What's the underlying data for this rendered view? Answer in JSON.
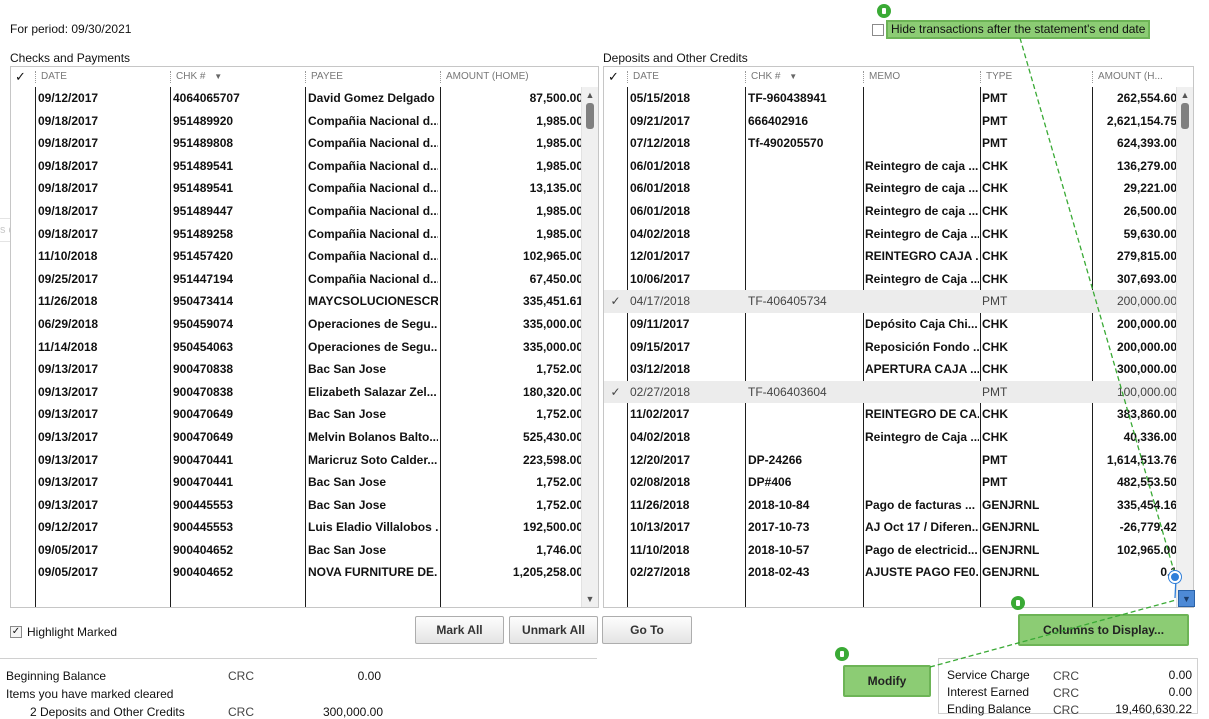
{
  "period_label": "For period: 09/30/2021",
  "hide_transactions_label": "Hide transactions after the statement's end date",
  "ghost_text": "s doin",
  "checks": {
    "title": "Checks and Payments",
    "columns": [
      "✓",
      "DATE",
      "CHK #",
      "PAYEE",
      "AMOUNT (HOME)"
    ],
    "sort_arrow": "▼",
    "rows": [
      {
        "date": "09/12/2017",
        "chk": "4064065707",
        "payee": "David Gomez Delgado",
        "amount": "87,500.00",
        "marked": false
      },
      {
        "date": "09/18/2017",
        "chk": "951489920",
        "payee": "Compañia Nacional d...",
        "amount": "1,985.00",
        "marked": false
      },
      {
        "date": "09/18/2017",
        "chk": "951489808",
        "payee": "Compañia Nacional d...",
        "amount": "1,985.00",
        "marked": false
      },
      {
        "date": "09/18/2017",
        "chk": "951489541",
        "payee": "Compañia Nacional d...",
        "amount": "1,985.00",
        "marked": false
      },
      {
        "date": "09/18/2017",
        "chk": "951489541",
        "payee": "Compañia Nacional d...",
        "amount": "13,135.00",
        "marked": false
      },
      {
        "date": "09/18/2017",
        "chk": "951489447",
        "payee": "Compañia Nacional d...",
        "amount": "1,985.00",
        "marked": false
      },
      {
        "date": "09/18/2017",
        "chk": "951489258",
        "payee": "Compañia Nacional d...",
        "amount": "1,985.00",
        "marked": false
      },
      {
        "date": "11/10/2018",
        "chk": "951457420",
        "payee": "Compañia Nacional d...",
        "amount": "102,965.00",
        "marked": false
      },
      {
        "date": "09/25/2017",
        "chk": "951447194",
        "payee": "Compañia Nacional d...",
        "amount": "67,450.00",
        "marked": false
      },
      {
        "date": "11/26/2018",
        "chk": "950473414",
        "payee": "MAYCSOLUCIONESCR...",
        "amount": "335,451.61",
        "marked": false
      },
      {
        "date": "06/29/2018",
        "chk": "950459074",
        "payee": "Operaciones de Segu...",
        "amount": "335,000.00",
        "marked": false
      },
      {
        "date": "11/14/2018",
        "chk": "950454063",
        "payee": "Operaciones de Segu...",
        "amount": "335,000.00",
        "marked": false
      },
      {
        "date": "09/13/2017",
        "chk": "900470838",
        "payee": "Bac San Jose",
        "amount": "1,752.00",
        "marked": false
      },
      {
        "date": "09/13/2017",
        "chk": "900470838",
        "payee": "Elizabeth Salazar Zel...",
        "amount": "180,320.00",
        "marked": false
      },
      {
        "date": "09/13/2017",
        "chk": "900470649",
        "payee": "Bac San Jose",
        "amount": "1,752.00",
        "marked": false
      },
      {
        "date": "09/13/2017",
        "chk": "900470649",
        "payee": "Melvin Bolanos Balto...",
        "amount": "525,430.00",
        "marked": false
      },
      {
        "date": "09/13/2017",
        "chk": "900470441",
        "payee": "Maricruz Soto Calder...",
        "amount": "223,598.00",
        "marked": false
      },
      {
        "date": "09/13/2017",
        "chk": "900470441",
        "payee": "Bac San Jose",
        "amount": "1,752.00",
        "marked": false
      },
      {
        "date": "09/13/2017",
        "chk": "900445553",
        "payee": "Bac San Jose",
        "amount": "1,752.00",
        "marked": false
      },
      {
        "date": "09/12/2017",
        "chk": "900445553",
        "payee": "Luis Eladio Villalobos ...",
        "amount": "192,500.00",
        "marked": false
      },
      {
        "date": "09/05/2017",
        "chk": "900404652",
        "payee": "Bac San Jose",
        "amount": "1,746.00",
        "marked": false
      },
      {
        "date": "09/05/2017",
        "chk": "900404652",
        "payee": "NOVA FURNITURE DE...",
        "amount": "1,205,258.00",
        "marked": false
      }
    ]
  },
  "deposits": {
    "title": "Deposits and Other Credits",
    "columns": [
      "✓",
      "DATE",
      "CHK #",
      "MEMO",
      "TYPE",
      "AMOUNT (H..."
    ],
    "sort_arrow": "▼",
    "rows": [
      {
        "date": "05/15/2018",
        "chk": "TF-960438941",
        "memo": "",
        "type": "PMT",
        "amount": "262,554.60",
        "marked": false
      },
      {
        "date": "09/21/2017",
        "chk": "666402916",
        "memo": "",
        "type": "PMT",
        "amount": "2,621,154.75",
        "marked": false
      },
      {
        "date": "07/12/2018",
        "chk": "Tf-490205570",
        "memo": "",
        "type": "PMT",
        "amount": "624,393.00",
        "marked": false
      },
      {
        "date": "06/01/2018",
        "chk": "",
        "memo": "Reintegro de caja ...",
        "type": "CHK",
        "amount": "136,279.00",
        "marked": false
      },
      {
        "date": "06/01/2018",
        "chk": "",
        "memo": "Reintegro de caja ...",
        "type": "CHK",
        "amount": "29,221.00",
        "marked": false
      },
      {
        "date": "06/01/2018",
        "chk": "",
        "memo": "Reintegro de caja ...",
        "type": "CHK",
        "amount": "26,500.00",
        "marked": false
      },
      {
        "date": "04/02/2018",
        "chk": "",
        "memo": "Reintegro de Caja ...",
        "type": "CHK",
        "amount": "59,630.00",
        "marked": false
      },
      {
        "date": "12/01/2017",
        "chk": "",
        "memo": "REINTEGRO CAJA ...",
        "type": "CHK",
        "amount": "279,815.00",
        "marked": false
      },
      {
        "date": "10/06/2017",
        "chk": "",
        "memo": "Reintegro de Caja ...",
        "type": "CHK",
        "amount": "307,693.00",
        "marked": false
      },
      {
        "date": "04/17/2018",
        "chk": "TF-406405734",
        "memo": "",
        "type": "PMT",
        "amount": "200,000.00",
        "marked": true
      },
      {
        "date": "09/11/2017",
        "chk": "",
        "memo": "Depósito Caja Chi...",
        "type": "CHK",
        "amount": "200,000.00",
        "marked": false
      },
      {
        "date": "09/15/2017",
        "chk": "",
        "memo": "Reposición Fondo ...",
        "type": "CHK",
        "amount": "200,000.00",
        "marked": false
      },
      {
        "date": "03/12/2018",
        "chk": "",
        "memo": "APERTURA CAJA ...",
        "type": "CHK",
        "amount": "300,000.00",
        "marked": false
      },
      {
        "date": "02/27/2018",
        "chk": "TF-406403604",
        "memo": "",
        "type": "PMT",
        "amount": "100,000.00",
        "marked": true
      },
      {
        "date": "11/02/2017",
        "chk": "",
        "memo": "REINTEGRO DE CA...",
        "type": "CHK",
        "amount": "383,860.00",
        "marked": false
      },
      {
        "date": "04/02/2018",
        "chk": "",
        "memo": "Reintegro de Caja ...",
        "type": "CHK",
        "amount": "40,336.00",
        "marked": false
      },
      {
        "date": "12/20/2017",
        "chk": "DP-24266",
        "memo": "",
        "type": "PMT",
        "amount": "1,614,513.76",
        "marked": false
      },
      {
        "date": "02/08/2018",
        "chk": "DP#406",
        "memo": "",
        "type": "PMT",
        "amount": "482,553.50",
        "marked": false
      },
      {
        "date": "11/26/2018",
        "chk": "2018-10-84",
        "memo": "Pago de facturas ...",
        "type": "GENJRNL",
        "amount": "335,454.16",
        "marked": false
      },
      {
        "date": "10/13/2017",
        "chk": "2017-10-73",
        "memo": "AJ Oct 17 / Diferen...",
        "type": "GENJRNL",
        "amount": "-26,779.42",
        "marked": false
      },
      {
        "date": "11/10/2018",
        "chk": "2018-10-57",
        "memo": "Pago de electricid...",
        "type": "GENJRNL",
        "amount": "102,965.00",
        "marked": false
      },
      {
        "date": "02/27/2018",
        "chk": "2018-02-43",
        "memo": "AJUSTE PAGO FE0...",
        "type": "GENJRNL",
        "amount": "0.1",
        "marked": false
      }
    ]
  },
  "highlight_marked_label": "Highlight Marked",
  "buttons": {
    "mark_all": "Mark All",
    "unmark_all": "Unmark All",
    "go_to": "Go To",
    "columns_to_display": "Columns to Display...",
    "modify": "Modify"
  },
  "summary_left": {
    "beginning_balance_label": "Beginning Balance",
    "beginning_balance_currency": "CRC",
    "beginning_balance_value": "0.00",
    "items_marked_label": "Items you have marked cleared",
    "deposits_label": "2   Deposits and Other Credits",
    "deposits_currency": "CRC",
    "deposits_value": "300,000.00"
  },
  "summary_right": {
    "service_charge_label": "Service Charge",
    "service_charge_currency": "CRC",
    "service_charge_value": "0.00",
    "interest_earned_label": "Interest Earned",
    "interest_earned_currency": "CRC",
    "interest_earned_value": "0.00",
    "ending_balance_label": "Ending Balance",
    "ending_balance_currency": "CRC",
    "ending_balance_value": "19,460,630.22"
  },
  "colors": {
    "highlight_green": "#8ccc74",
    "highlight_border": "#6db456",
    "marked_row": "#ececec",
    "annotation_blue": "#2f7fd9"
  }
}
